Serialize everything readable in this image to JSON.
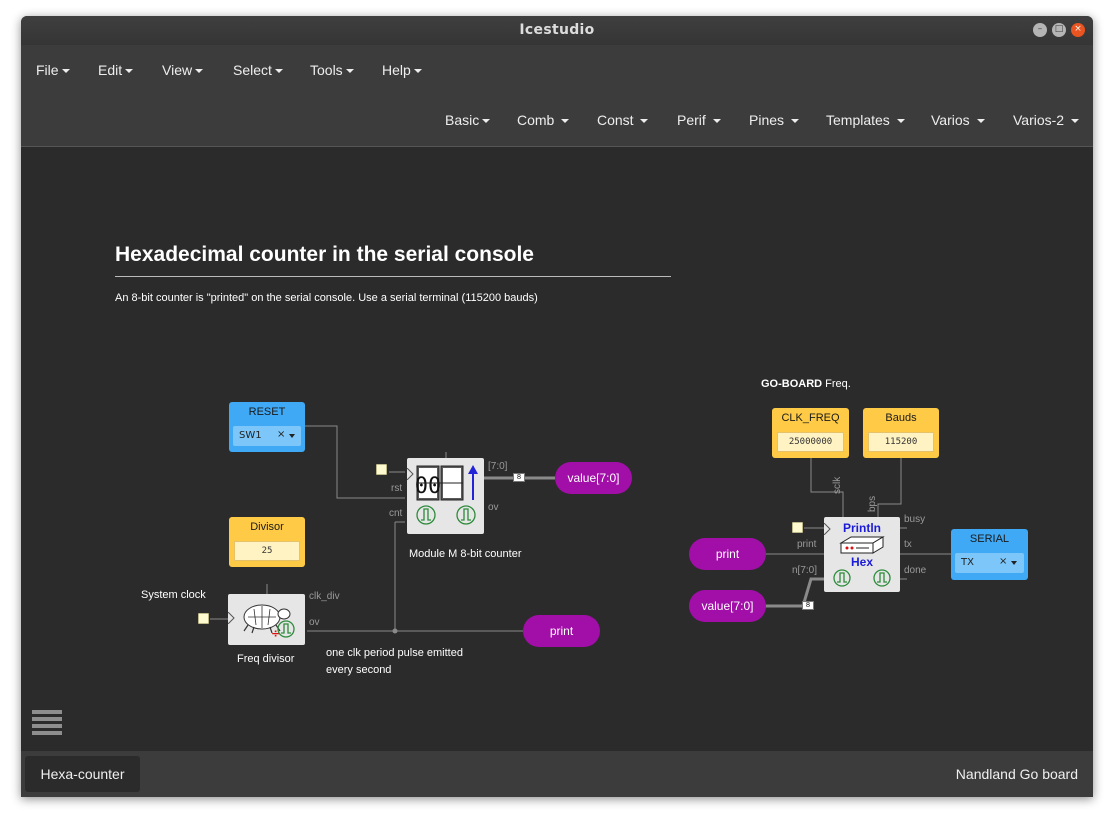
{
  "window": {
    "title": "Icestudio"
  },
  "menubar": {
    "items": [
      "File",
      "Edit",
      "View",
      "Select",
      "Tools",
      "Help"
    ]
  },
  "toolbar": {
    "items": [
      "Basic",
      "Comb",
      "Const",
      "Perif",
      "Pines",
      "Templates",
      "Varios",
      "Varios-2"
    ]
  },
  "canvas": {
    "heading": "Hexadecimal counter in the serial console",
    "subtitle": "An 8-bit counter is \"printed\" on the serial console. Use a serial terminal (115200 bauds)",
    "board_note_bold": "GO-BOARD",
    "board_note_rest": " Freq.",
    "reset_block": {
      "title": "RESET",
      "value": "SW1",
      "clear": "×"
    },
    "divisor_block": {
      "title": "Divisor",
      "value": "25"
    },
    "clk_freq_block": {
      "title": "CLK_FREQ",
      "value": "25000000"
    },
    "bauds_block": {
      "title": "Bauds",
      "value": "115200"
    },
    "serial_block": {
      "title": "SERIAL",
      "value": "TX",
      "clear": "×"
    },
    "counter": {
      "label": "Module M 8-bit counter",
      "digits": "00",
      "ports": {
        "rst": "rst",
        "cnt": "cnt",
        "out": "[7:0]",
        "ov": "ov"
      }
    },
    "freq_divisor": {
      "label": "Freq divisor",
      "ports": {
        "clk_div": "clk_div",
        "ov": "ov"
      }
    },
    "println": {
      "line1": "Println",
      "line2": "Hex",
      "ports": {
        "sclk": "sclk",
        "bps": "bps",
        "print": "print",
        "n": "n[7:0]",
        "busy": "busy",
        "tx": "tx",
        "done": "done"
      }
    },
    "labels": {
      "value_out": "value[7:0]",
      "print_out": "print",
      "print_in": "print",
      "value_in": "value[7:0]",
      "system_clock": "System clock",
      "pulse_note_1": "one clk period pulse emitted",
      "pulse_note_2": "every second",
      "bus_width_1": "8",
      "bus_width_2": "8"
    }
  },
  "bottombar": {
    "tab": "Hexa-counter",
    "board": "Nandland Go board"
  },
  "colors": {
    "accent_blue": "#3fa9f5",
    "const_yellow": "#ffcb46",
    "label_purple": "#a20ea8",
    "background": "#2b2b2b",
    "close_button": "#e95420"
  }
}
